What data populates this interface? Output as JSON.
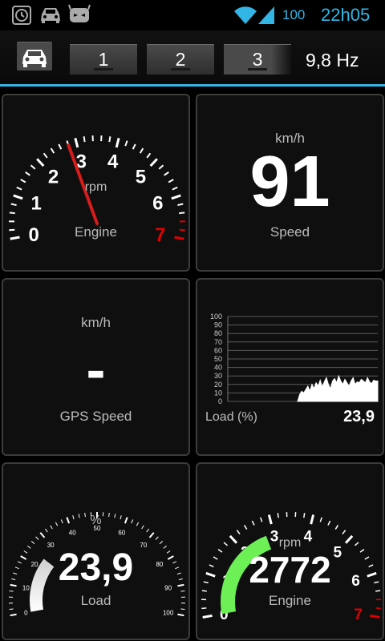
{
  "status_bar": {
    "icons": [
      "alarm-icon",
      "car-icon",
      "android-icon",
      "wifi-icon",
      "signal-icon"
    ],
    "battery": "100",
    "time": "22h05",
    "accent": "#33b5e5"
  },
  "toolbar": {
    "car_icon": "car-icon",
    "pages": [
      "1",
      "2",
      "3"
    ],
    "frequency": "9,8 Hz"
  },
  "panels": {
    "engine_dial": {
      "unit": "rpm",
      "label": "Engine",
      "ticks": [
        "0",
        "1",
        "2",
        "3",
        "4",
        "5",
        "6",
        "7"
      ],
      "redline_color": "#e00000",
      "needle_value": 2.8
    },
    "speed": {
      "unit": "km/h",
      "value": "91",
      "label": "Speed"
    },
    "gps_speed": {
      "unit": "km/h",
      "value": "-",
      "label": "GPS Speed"
    },
    "load_chart": {
      "label": "Load (%)",
      "value": "23,9"
    },
    "load_dial": {
      "unit": "%",
      "value": "23,9",
      "label": "Load",
      "ticks": [
        "0",
        "10",
        "20",
        "30",
        "40",
        "50",
        "60",
        "70",
        "80",
        "90",
        "100"
      ],
      "fill_fraction": 0.239
    },
    "engine_arc": {
      "unit": "rpm",
      "value": "2772",
      "label": "Engine",
      "ticks": [
        "0",
        "1",
        "2",
        "3",
        "4",
        "5",
        "6",
        "7"
      ],
      "fill_value": 2.772,
      "fill_color": "#6cf056",
      "redline_color": "#e00000"
    }
  },
  "chart_data": {
    "type": "line",
    "ylabel": "Load (%)",
    "ylim": [
      0,
      100
    ],
    "yticks": [
      "0",
      "10",
      "20",
      "30",
      "40",
      "50",
      "60",
      "70",
      "80",
      "90",
      "100"
    ],
    "grid": true,
    "series": [
      {
        "values": [
          0,
          8,
          12,
          10,
          14,
          18,
          12,
          20,
          15,
          22,
          18,
          25,
          17,
          23,
          28,
          20,
          15,
          24,
          27,
          22,
          30,
          24,
          20,
          26,
          22,
          18,
          24,
          28,
          20,
          23,
          22,
          26,
          24,
          22,
          28,
          23,
          21,
          25,
          24,
          24
        ]
      }
    ]
  }
}
